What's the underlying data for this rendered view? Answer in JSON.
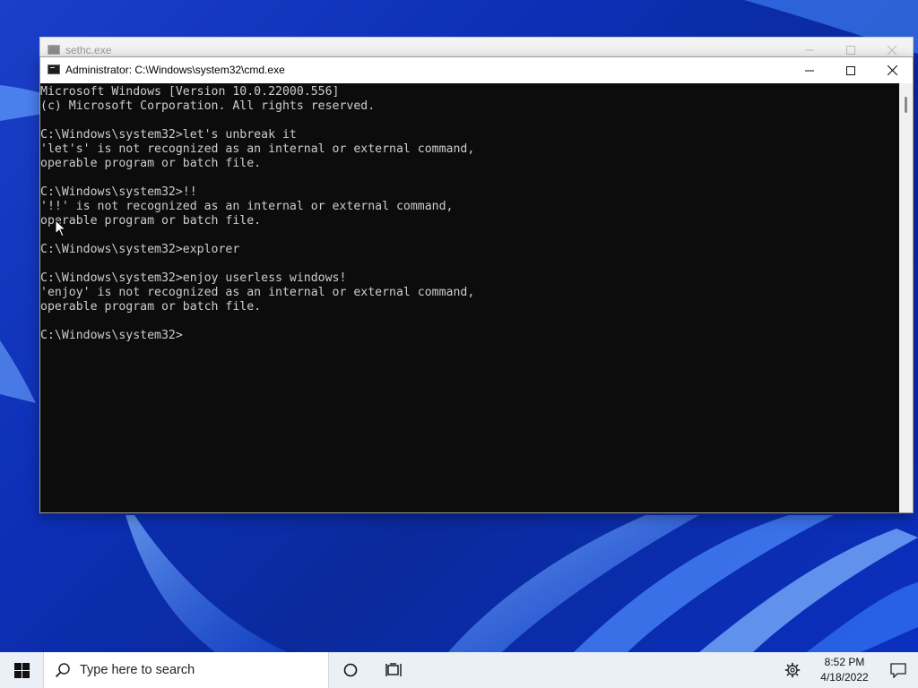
{
  "windows": {
    "back": {
      "title": "sethc.exe"
    },
    "cmd": {
      "title": "Administrator: C:\\Windows\\system32\\cmd.exe",
      "console_lines": [
        "Microsoft Windows [Version 10.0.22000.556]",
        "(c) Microsoft Corporation. All rights reserved.",
        "",
        "C:\\Windows\\system32>let's unbreak it",
        "'let's' is not recognized as an internal or external command,",
        "operable program or batch file.",
        "",
        "C:\\Windows\\system32>!!",
        "'!!' is not recognized as an internal or external command,",
        "operable program or batch file.",
        "",
        "C:\\Windows\\system32>explorer",
        "",
        "C:\\Windows\\system32>enjoy userless windows!",
        "'enjoy' is not recognized as an internal or external command,",
        "operable program or batch file.",
        "",
        "C:\\Windows\\system32>"
      ]
    }
  },
  "taskbar": {
    "search_placeholder": "Type here to search",
    "time": "8:52 PM",
    "date": "4/18/2022",
    "icons": [
      "windows-start-icon",
      "search-icon",
      "cortana-icon",
      "task-view-icon",
      "settings-gear-icon",
      "notification-icon"
    ]
  },
  "colors": {
    "console_bg": "#0c0c0c",
    "console_text": "#cccccc",
    "taskbar_bg": "#eaf0f6",
    "wallpaper_blue": "#0c2fb6"
  }
}
